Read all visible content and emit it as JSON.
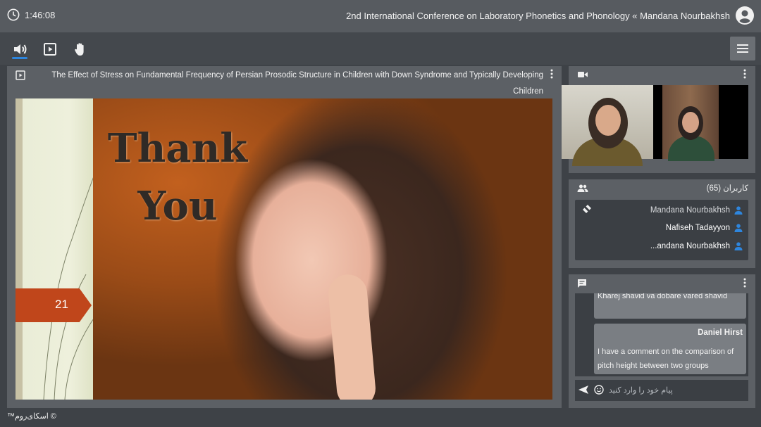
{
  "header": {
    "timer": "1:46:08",
    "title": "2nd International Conference on Laboratory Phonetics and Phonology « Mandana Nourbakhsh"
  },
  "toolbar": {
    "icons": [
      "speaker-icon",
      "play-square-icon",
      "hand-icon",
      "hamburger-menu-icon"
    ],
    "accent": "#2e86de"
  },
  "presentation": {
    "title": "The Effect of Stress on Fundamental Frequency of Persian Prosodic Structure in Children with Down Syndrome and Typically Developing Children",
    "slide": {
      "heading_line1": "Thank",
      "heading_line2": "You",
      "page_number": "21",
      "badge_color": "#c0461b"
    }
  },
  "users": {
    "title": "کاربران (65)",
    "list": [
      {
        "name": "Mandana Nourbakhsh"
      },
      {
        "name": "Nafiseh Tadayyon"
      },
      {
        "name": "...andana Nourbakhsh"
      }
    ]
  },
  "chat": {
    "previous_message": "Kharej shavid va dobare vared shavid",
    "messages": [
      {
        "author": "Daniel Hirst",
        "text": "I have a comment on the comparison of pitch height between two groups"
      }
    ],
    "input_placeholder": "پیام خود را وارد کنید"
  },
  "footer": {
    "brand": "© اسکای‌روم™"
  }
}
